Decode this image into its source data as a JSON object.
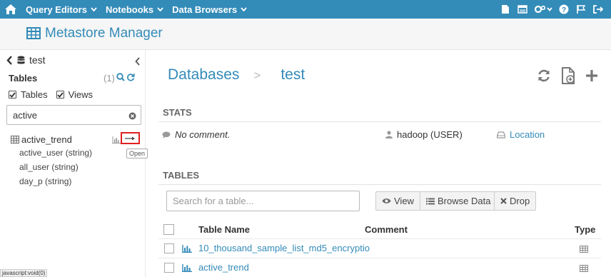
{
  "nav": {
    "items": [
      {
        "label": "Query Editors"
      },
      {
        "label": "Notebooks"
      },
      {
        "label": "Data Browsers"
      }
    ]
  },
  "page": {
    "title": "Metastore Manager"
  },
  "sidebar": {
    "db_name": "test",
    "tables_header": "Tables",
    "count": "(1)",
    "check_tables": "Tables",
    "check_views": "Views",
    "filter_value": "active",
    "table": {
      "name": "active_trend",
      "open_tooltip": "Open",
      "columns": [
        "active_user (string)",
        "all_user (string)",
        "day_p (string)"
      ]
    },
    "status_text": "javascript:void(0)"
  },
  "main": {
    "breadcrumb": {
      "root": "Databases",
      "separator": ">",
      "current": "test"
    },
    "stats_header": "STATS",
    "comment": "No comment.",
    "owner": "hadoop (USER)",
    "location": "Location",
    "tables_header": "TABLES",
    "search_placeholder": "Search for a table...",
    "buttons": {
      "view": "View",
      "browse": "Browse Data",
      "drop": "Drop"
    },
    "columns": {
      "name": "Table Name",
      "comment": "Comment",
      "type": "Type"
    },
    "rows": [
      {
        "name": "10_thousand_sample_list_md5_encryptio"
      },
      {
        "name": "active_trend"
      }
    ]
  },
  "colors": {
    "brand": "#338bb8",
    "highlight": "#e02020"
  }
}
